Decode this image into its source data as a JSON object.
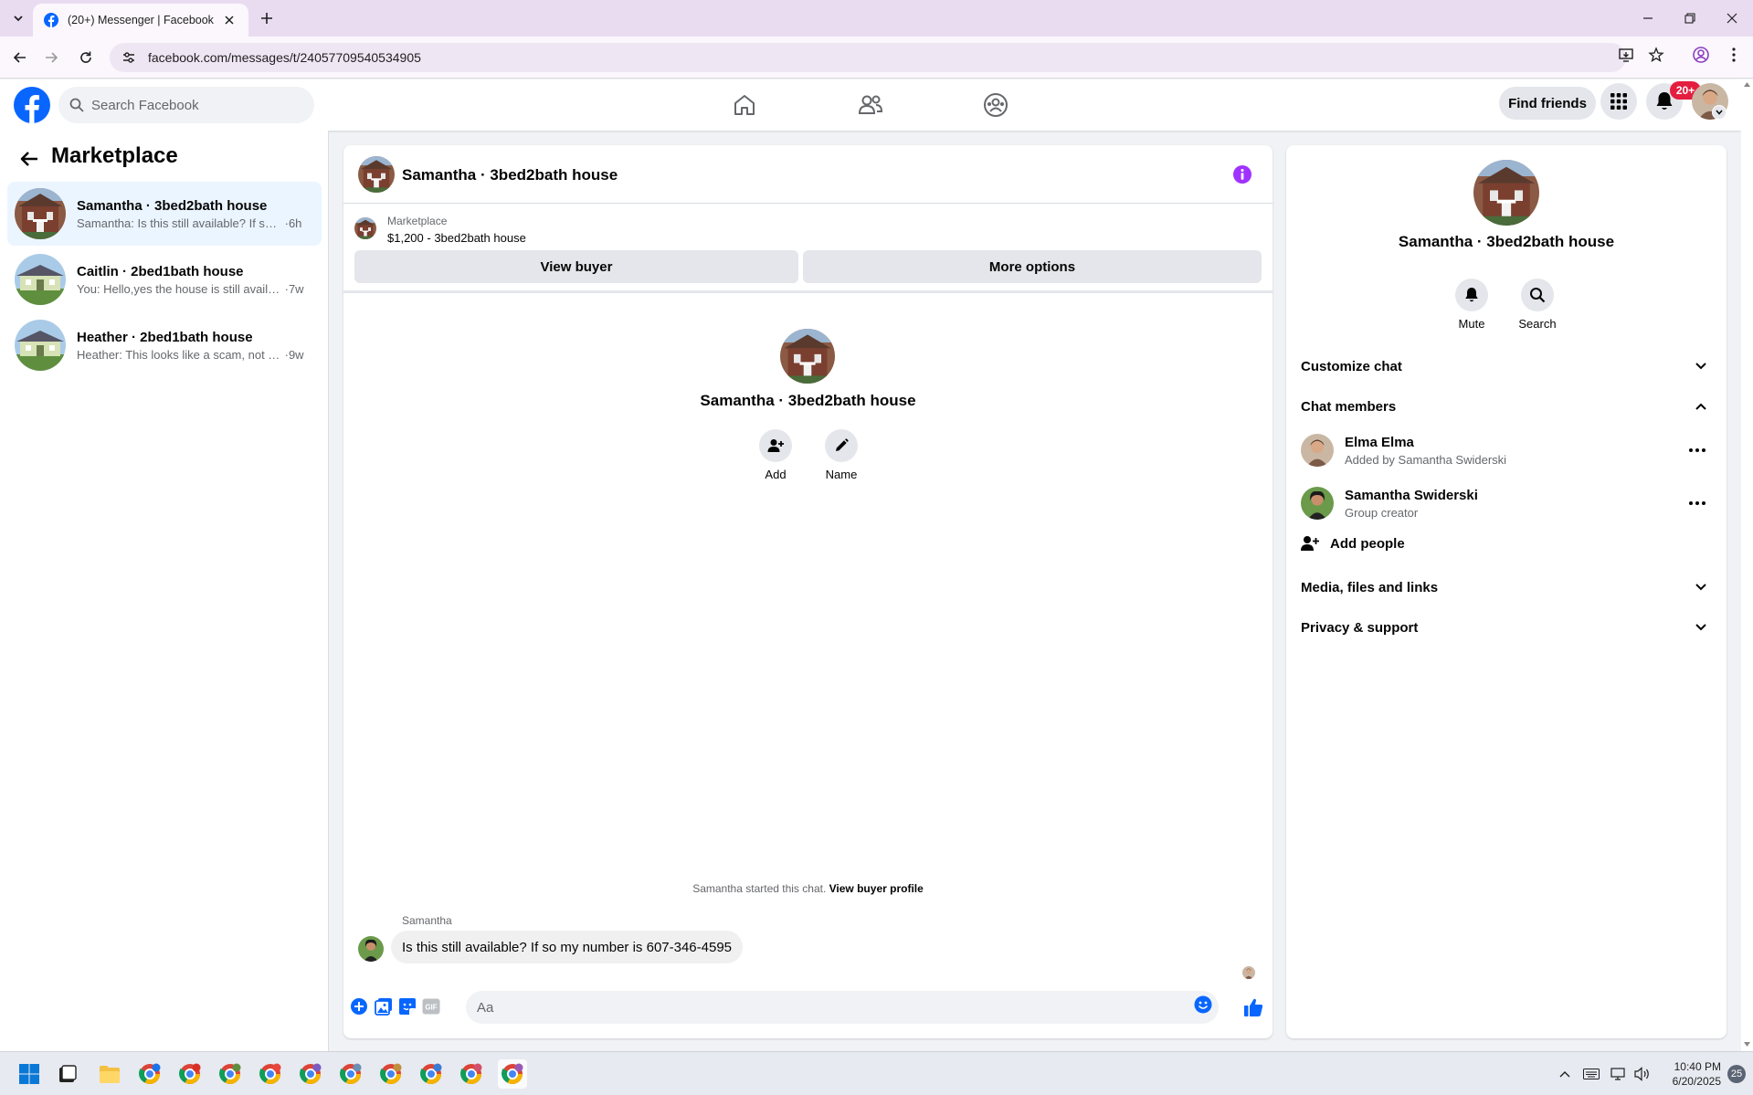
{
  "browser": {
    "tab_title": "(20+) Messenger | Facebook",
    "url": "facebook.com/messages/t/24057709540534905"
  },
  "header": {
    "search_placeholder": "Search Facebook",
    "find_friends_label": "Find friends",
    "notification_badge": "20+"
  },
  "sidebar": {
    "title": "Marketplace",
    "conversations": [
      {
        "name": "Samantha · 3bed2bath house",
        "preview": "Samantha: Is this still available? If so ...",
        "time": "·6h",
        "active": true
      },
      {
        "name": "Caitlin · 2bed1bath house",
        "preview": "You: Hello,yes the house is still availa...",
        "time": "·7w",
        "active": false
      },
      {
        "name": "Heather · 2bed1bath house",
        "preview": "Heather: This looks like a scam, not p...",
        "time": "·9w",
        "active": false
      }
    ]
  },
  "chat": {
    "title": "Samantha · 3bed2bath house",
    "listing_source": "Marketplace",
    "listing_title": "$1,200 - 3bed2bath house",
    "view_buyer_label": "View buyer",
    "more_options_label": "More options",
    "intro_title": "Samantha · 3bed2bath house",
    "add_label": "Add",
    "name_label": "Name",
    "started_text": "Samantha started this chat.",
    "view_buyer_profile_label": "View buyer profile",
    "message_sender": "Samantha",
    "message_text": "Is this still available?  If so my number is 607-346-4595",
    "input_placeholder": "Aa"
  },
  "info_panel": {
    "title": "Samantha · 3bed2bath house",
    "mute_label": "Mute",
    "search_label": "Search",
    "sections": {
      "customize": "Customize chat",
      "members": "Chat members",
      "media": "Media, files and links",
      "privacy": "Privacy & support"
    },
    "members": [
      {
        "name": "Elma Elma",
        "sub": "Added by Samantha Swiderski"
      },
      {
        "name": "Samantha Swiderski",
        "sub": "Group creator"
      }
    ],
    "add_people_label": "Add people"
  },
  "taskbar": {
    "time": "10:40 PM",
    "date": "6/20/2025",
    "notification_count": "25"
  },
  "colors": {
    "facebook_blue": "#0866ff",
    "messenger_purple": "#a033ff",
    "active_conversation": "#ebf5ff",
    "badge_red": "#e41e3f"
  }
}
